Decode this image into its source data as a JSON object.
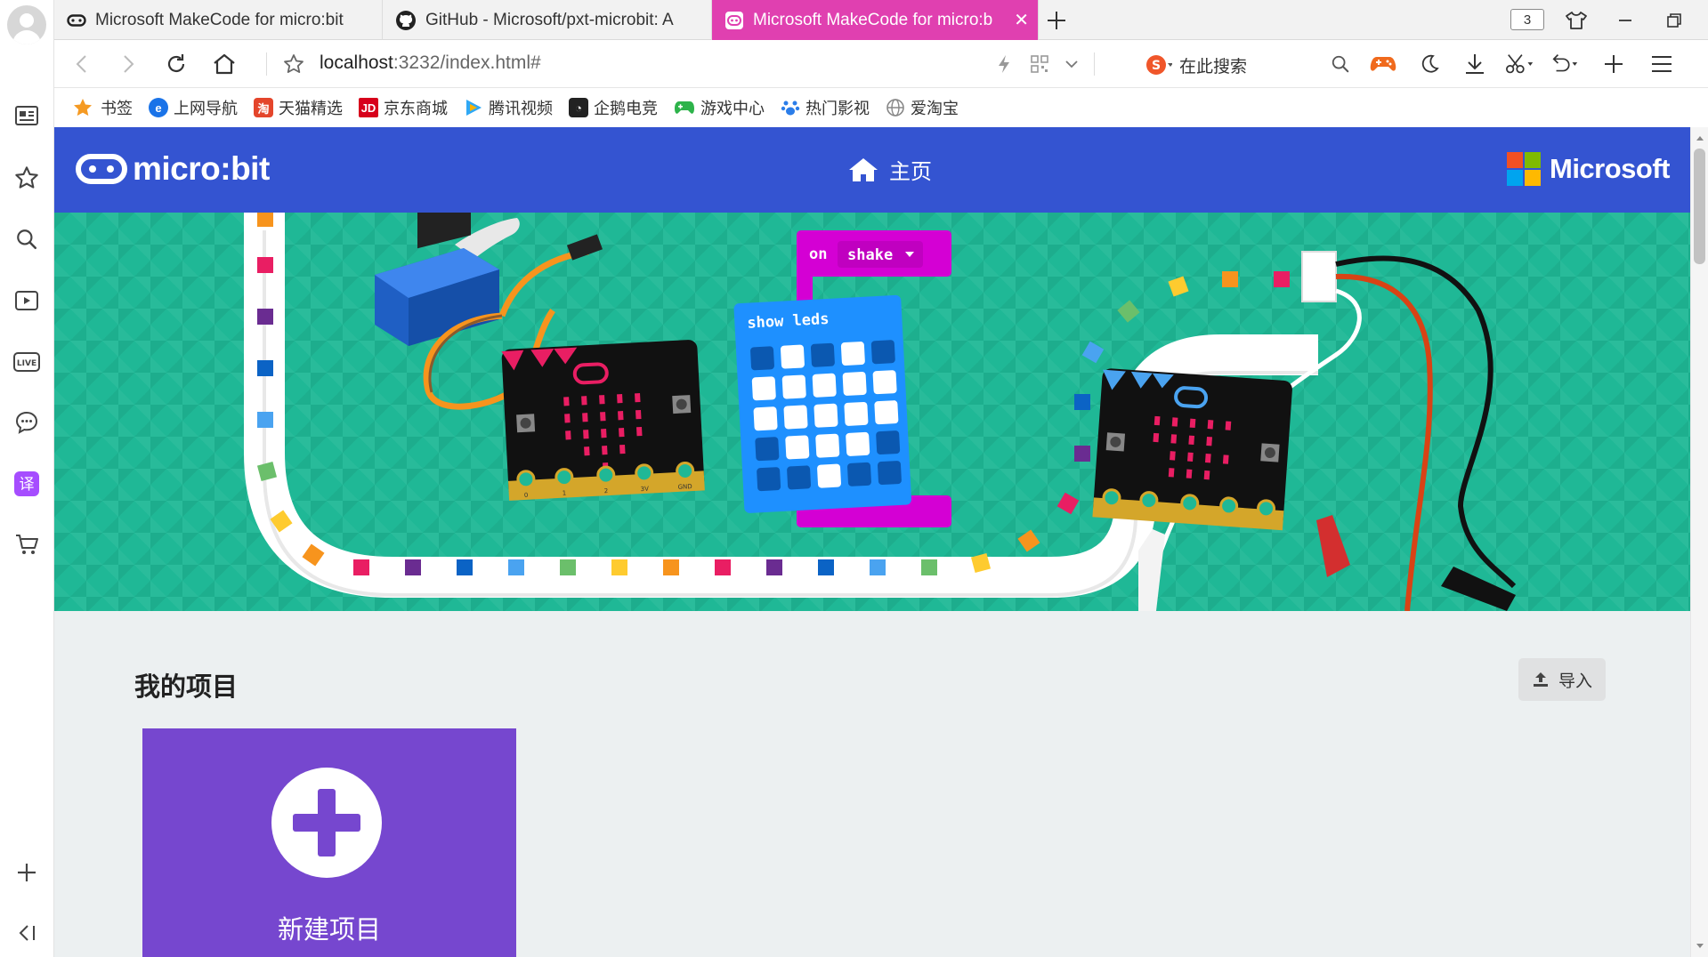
{
  "tabs": [
    {
      "label": "Microsoft MakeCode for micro:bit",
      "active": false
    },
    {
      "label": "GitHub - Microsoft/pxt-microbit: A",
      "active": false
    },
    {
      "label": "Microsoft MakeCode for micro:b",
      "active": true
    }
  ],
  "tab_count": "3",
  "address": {
    "host": "localhost",
    "path": ":3232/index.html#"
  },
  "search": {
    "placeholder": "在此搜索"
  },
  "bookmarks": [
    {
      "label": "书签",
      "icon": "star-icon",
      "color": "#f59a23"
    },
    {
      "label": "上网导航",
      "icon": "ie-icon",
      "color": "#1a73e8"
    },
    {
      "label": "天猫精选",
      "icon": "tmall-icon",
      "color": "#e4452b"
    },
    {
      "label": "京东商城",
      "icon": "jd-icon",
      "color": "#d7001b"
    },
    {
      "label": "腾讯视频",
      "icon": "tencent-video-icon",
      "color": "#2fa8f5"
    },
    {
      "label": "企鹅电竞",
      "icon": "penguin-icon",
      "color": "#222222"
    },
    {
      "label": "游戏中心",
      "icon": "gamepad-icon",
      "color": "#2db34a"
    },
    {
      "label": "热门影视",
      "icon": "paw-icon",
      "color": "#2b7de9"
    },
    {
      "label": "爱淘宝",
      "icon": "globe-icon",
      "color": "#888888"
    }
  ],
  "page": {
    "logo_text": "micro:bit",
    "home_label": "主页",
    "microsoft_label": "Microsoft",
    "hero": {
      "on_label": "on",
      "event_label": "shake",
      "block_label": "show leds",
      "pin_labels": [
        "0",
        "1",
        "2",
        "3V",
        "GND"
      ]
    },
    "projects_title": "我的项目",
    "import_label": "导入",
    "new_project_label": "新建项目"
  },
  "colors": {
    "header_blue": "#3454d1",
    "hero_green": "#1fb896",
    "new_project_purple": "#7647cf",
    "block_magenta": "#d400d4",
    "block_blue": "#1e90ff"
  }
}
